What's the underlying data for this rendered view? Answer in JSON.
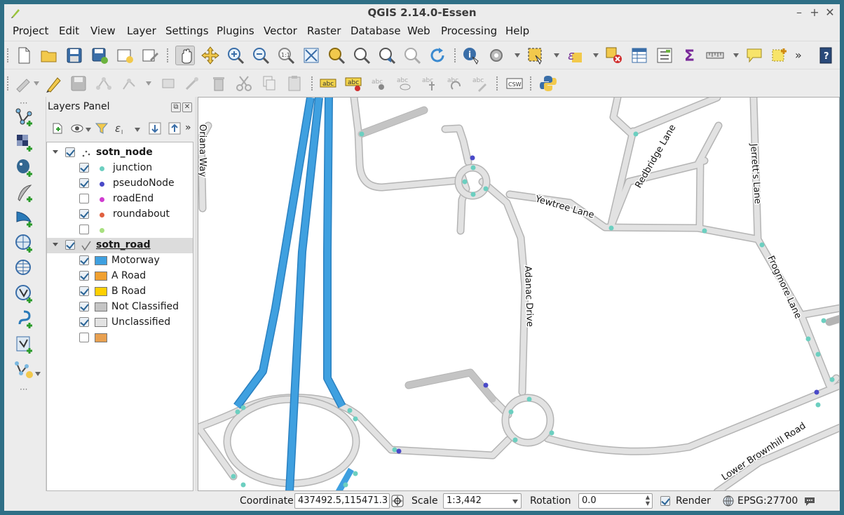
{
  "window": {
    "title": "QGIS 2.14.0-Essen"
  },
  "menubar": [
    "Project",
    "Edit",
    "View",
    "Layer",
    "Settings",
    "Plugins",
    "Vector",
    "Raster",
    "Database",
    "Web",
    "Processing",
    "Help"
  ],
  "layers_panel": {
    "title": "Layers Panel",
    "groups": [
      {
        "name": "sotn_node",
        "checked": true,
        "items": [
          {
            "label": "junction",
            "checked": true,
            "color": "#6ccfc0"
          },
          {
            "label": "pseudoNode",
            "checked": true,
            "color": "#4a4ac8"
          },
          {
            "label": "roadEnd",
            "checked": false,
            "color": "#d03cd0"
          },
          {
            "label": "roundabout",
            "checked": true,
            "color": "#e06040"
          },
          {
            "label": "",
            "checked": false,
            "color": "#a8e080"
          }
        ]
      },
      {
        "name": "sotn_road",
        "checked": true,
        "items": [
          {
            "label": "Motorway",
            "checked": true,
            "color": "#3fa0e0"
          },
          {
            "label": "A Road",
            "checked": true,
            "color": "#f0a030"
          },
          {
            "label": "B Road",
            "checked": true,
            "color": "#ffd000"
          },
          {
            "label": "Not Classified",
            "checked": true,
            "color": "#c4c4c4"
          },
          {
            "label": "Unclassified",
            "checked": true,
            "color": "#e2e2e2"
          },
          {
            "label": "",
            "checked": false,
            "color": "#e8a050"
          }
        ]
      }
    ]
  },
  "map": {
    "road_labels": [
      "Oriana Way",
      "Redbridge Lane",
      "Jerrett's Lane",
      "Yewtree Lane",
      "Adanac Drive",
      "Frogmore Lane",
      "Lower Brownhill Road"
    ],
    "colors": {
      "motorway": "#3fa0e0",
      "road_casing": "#b4b4b4",
      "road_fill": "#e2e2e2",
      "junction": "#6ccfc0",
      "pseudo_node": "#4a4ac8"
    }
  },
  "statusbar": {
    "coordinate_label": "Coordinate",
    "coordinate_value": "437492.5,115471.3",
    "scale_label": "Scale",
    "scale_value": "1:3,442",
    "rotation_label": "Rotation",
    "rotation_value": "0.0",
    "render_label": "Render",
    "render_checked": true,
    "crs": "EPSG:27700"
  }
}
